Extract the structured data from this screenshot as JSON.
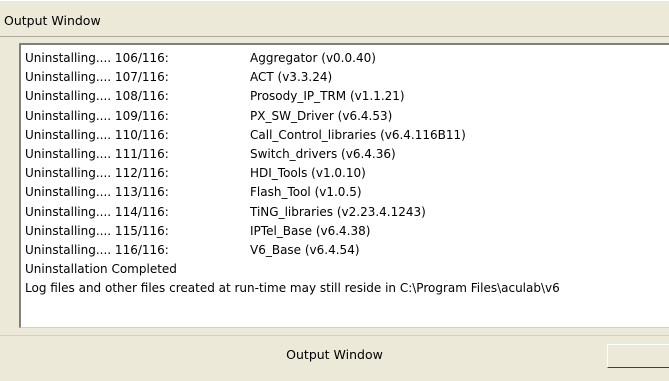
{
  "window": {
    "title": "Output Window"
  },
  "output": {
    "lines": [
      {
        "progress": "Uninstalling.... 106/116:",
        "package": "Aggregator (v0.0.40)"
      },
      {
        "progress": "Uninstalling.... 107/116:",
        "package": "ACT (v3.3.24)"
      },
      {
        "progress": "Uninstalling.... 108/116:",
        "package": "Prosody_IP_TRM (v1.1.21)"
      },
      {
        "progress": "Uninstalling.... 109/116:",
        "package": "PX_SW_Driver (v6.4.53)"
      },
      {
        "progress": "Uninstalling.... 110/116:",
        "package": "Call_Control_libraries (v6.4.116B11)"
      },
      {
        "progress": "Uninstalling.... 111/116:",
        "package": "Switch_drivers (v6.4.36)"
      },
      {
        "progress": "Uninstalling.... 112/116:",
        "package": "HDI_Tools (v1.0.10)"
      },
      {
        "progress": "Uninstalling.... 113/116:",
        "package": "Flash_Tool (v1.0.5)"
      },
      {
        "progress": "Uninstalling.... 114/116:",
        "package": "TiNG_libraries (v2.23.4.1243)"
      },
      {
        "progress": "Uninstalling.... 115/116:",
        "package": "IPTel_Base (v6.4.38)"
      },
      {
        "progress": "Uninstalling.... 116/116:",
        "package": "V6_Base (v6.4.54)"
      }
    ],
    "completed_message": "Uninstallation Completed",
    "log_message": "Log files and other files created at run-time may still reside in C:\\Program Files\\aculab\\v6"
  },
  "footer": {
    "label": "Output Window"
  }
}
